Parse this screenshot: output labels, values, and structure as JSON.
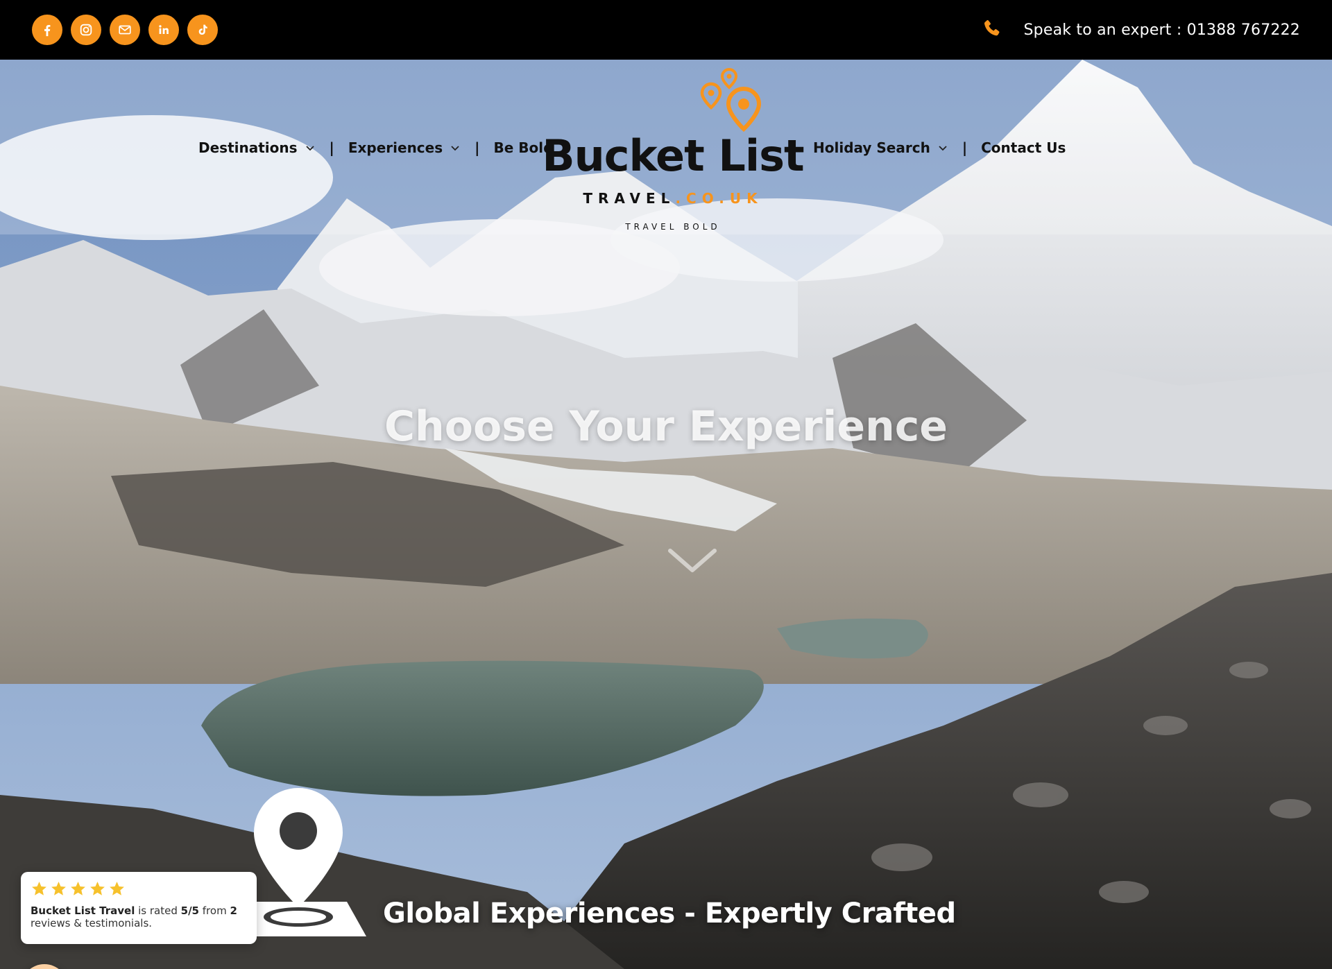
{
  "topbar": {
    "socials": [
      {
        "name": "facebook-icon"
      },
      {
        "name": "instagram-icon"
      },
      {
        "name": "email-icon"
      },
      {
        "name": "linkedin-icon"
      },
      {
        "name": "tiktok-icon"
      }
    ],
    "contact_text": "Speak to an expert : 01388 767222",
    "phone_icon": "phone-icon"
  },
  "nav": {
    "destinations": "Destinations",
    "experiences": "Experiences",
    "be_bold": "Be Bold",
    "holiday_search": "Holiday Search",
    "contact_us": "Contact Us",
    "separator": "|"
  },
  "logo": {
    "title": "Bucket List",
    "sub_main": "TRAVEL",
    "sub_accent": ".CO.UK",
    "tagline": "TRAVEL BOLD"
  },
  "hero": {
    "title": "Choose Your Experience",
    "subtitle": "Global Experiences - Expertly Crafted"
  },
  "review": {
    "stars": 5,
    "brand": "Bucket List Travel",
    "rated_text": " is rated ",
    "rating": "5/5",
    "from_text": " from ",
    "count": "2",
    "tail_text": " reviews & testimonials."
  },
  "colors": {
    "accent": "#f7941d",
    "topbar_bg": "#000000",
    "badge_bg": "#fbd0a3"
  }
}
